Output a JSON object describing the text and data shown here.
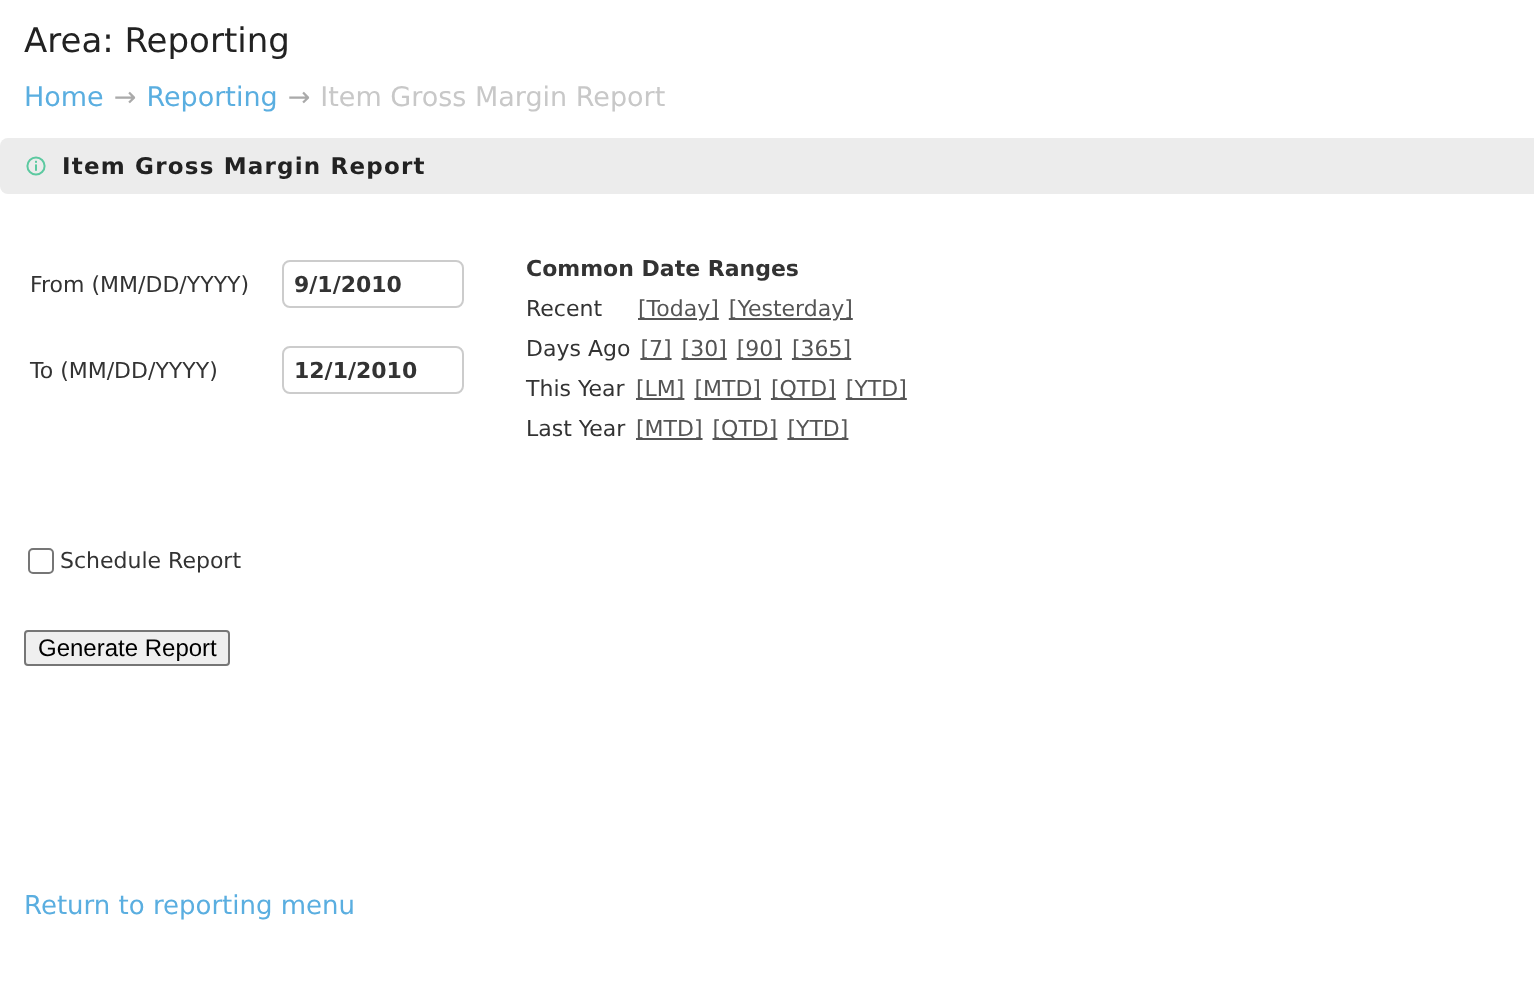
{
  "page_title": "Area: Reporting",
  "breadcrumb": [
    {
      "label": "Home",
      "kind": "link"
    },
    {
      "label": "→",
      "kind": "separator"
    },
    {
      "label": "Reporting",
      "kind": "link"
    },
    {
      "label": "→",
      "kind": "separator"
    },
    {
      "label": "Item Gross Margin Report",
      "kind": "current"
    }
  ],
  "panel": {
    "title": "Item Gross Margin Report"
  },
  "fields": [
    {
      "label": "From (MM/DD/YYYY)",
      "value": "9/1/2010"
    },
    {
      "label": "To (MM/DD/YYYY)",
      "value": "12/1/2010"
    }
  ],
  "date_ranges": {
    "title": "Common Date Ranges",
    "rows": [
      {
        "label": "Recent",
        "links": [
          "[Today]",
          "[Yesterday]"
        ]
      },
      {
        "label": "Days Ago",
        "links": [
          "[7]",
          "[30]",
          "[90]",
          "[365]"
        ]
      },
      {
        "label": "This Year",
        "links": [
          "[LM]",
          "[MTD]",
          "[QTD]",
          "[YTD]"
        ]
      },
      {
        "label": "Last Year",
        "links": [
          "[MTD]",
          "[QTD]",
          "[YTD]"
        ]
      }
    ]
  },
  "schedule": {
    "label": "Schedule Report",
    "checked": false
  },
  "generate_button": "Generate Report",
  "return_link": "Return to reporting menu"
}
